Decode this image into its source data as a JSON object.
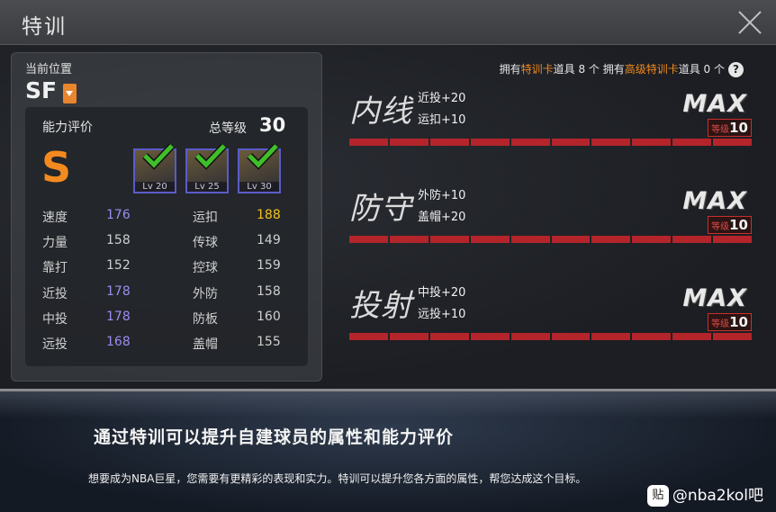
{
  "header": {
    "title": "特训"
  },
  "position": {
    "label": "当前位置",
    "value": "SF"
  },
  "rating": {
    "label": "能力评价",
    "grade": "S",
    "total_label": "总等级",
    "total_value": "30",
    "cards": [
      {
        "level": "Lv 20",
        "checked": true
      },
      {
        "level": "Lv 25",
        "checked": true
      },
      {
        "level": "Lv 30",
        "checked": true
      }
    ],
    "stats": [
      {
        "name": "速度",
        "value": "176",
        "color": "#9b8cf0"
      },
      {
        "name": "运扣",
        "value": "188",
        "color": "#f2c31c"
      },
      {
        "name": "力量",
        "value": "158",
        "color": "#cfcfcf"
      },
      {
        "name": "传球",
        "value": "149",
        "color": "#cfcfcf"
      },
      {
        "name": "靠打",
        "value": "152",
        "color": "#cfcfcf"
      },
      {
        "name": "控球",
        "value": "159",
        "color": "#cfcfcf"
      },
      {
        "name": "近投",
        "value": "178",
        "color": "#9b8cf0"
      },
      {
        "name": "外防",
        "value": "158",
        "color": "#cfcfcf"
      },
      {
        "name": "中投",
        "value": "178",
        "color": "#9b8cf0"
      },
      {
        "name": "防板",
        "value": "160",
        "color": "#cfcfcf"
      },
      {
        "name": "远投",
        "value": "168",
        "color": "#9b8cf0"
      },
      {
        "name": "盖帽",
        "value": "155",
        "color": "#cfcfcf"
      }
    ]
  },
  "ownership": {
    "p1": "拥有",
    "card1": "特训卡",
    "p2": "道具 8 个 拥有",
    "card2": "高级特训卡",
    "p3": "道具 0 个",
    "help": "?"
  },
  "trainings": [
    {
      "name": "内线",
      "bonus1": "近投+20",
      "bonus2": "运扣+10",
      "max": "MAX",
      "level_label": "等级",
      "level_value": "10",
      "progress": 1.0
    },
    {
      "name": "防守",
      "bonus1": "外防+10",
      "bonus2": "盖帽+20",
      "max": "MAX",
      "level_label": "等级",
      "level_value": "10",
      "progress": 1.0
    },
    {
      "name": "投射",
      "bonus1": "中投+20",
      "bonus2": "远投+10",
      "max": "MAX",
      "level_label": "等级",
      "level_value": "10",
      "progress": 1.0
    }
  ],
  "footer": {
    "title": "通过特训可以提升自建球员的属性和能力评价",
    "desc": "想要成为NBA巨星，您需要有更精彩的表现和实力。特训可以提升您各方面的属性，帮您达成这个目标。",
    "watermark_logo": "贴",
    "watermark": "@nba2kol吧"
  },
  "colors": {
    "accent": "#f28a1f",
    "bar": "#b3252a",
    "card_border": "#5a5cc8",
    "check": "#3fbf2a"
  }
}
